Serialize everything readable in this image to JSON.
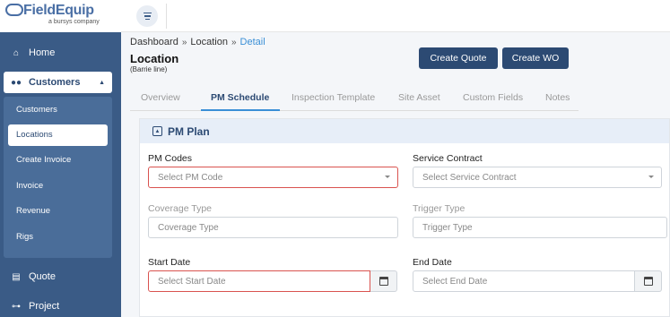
{
  "brand": {
    "name": "FieldEquip",
    "tagline": "a bursys company"
  },
  "sidebar": {
    "home": "Home",
    "customers": "Customers",
    "sub_items": [
      "Customers",
      "Locations",
      "Create Invoice",
      "Invoice",
      "Revenue",
      "Rigs"
    ],
    "active_sub": "Locations",
    "quote": "Quote",
    "project": "Project"
  },
  "breadcrumb": {
    "root": "Dashboard",
    "parent": "Location",
    "current": "Detail",
    "separator": "»"
  },
  "page": {
    "title": "Location",
    "subtitle": "(Barrie line)"
  },
  "actions": {
    "create_quote": "Create Quote",
    "create_wo": "Create WO"
  },
  "tabs": [
    "Overview",
    "PM Schedule",
    "Inspection Template",
    "Site Asset",
    "Custom Fields",
    "Notes"
  ],
  "active_tab": "PM Schedule",
  "pm_plan": {
    "title": "PM Plan",
    "pm_codes": {
      "label": "PM Codes",
      "placeholder": "Select PM Code"
    },
    "service_contract": {
      "label": "Service Contract",
      "placeholder": "Select Service Contract"
    },
    "coverage_type": {
      "label": "Coverage Type",
      "placeholder": "Coverage Type"
    },
    "trigger_type": {
      "label": "Trigger Type",
      "placeholder": "Trigger Type"
    },
    "start_date": {
      "label": "Start Date",
      "placeholder": "Select Start Date"
    },
    "end_date": {
      "label": "End Date",
      "placeholder": "Select End Date"
    }
  },
  "colors": {
    "sidebar": "#3a5b86",
    "primary_button": "#2c4a73",
    "accent": "#3a8fd6",
    "error": "#d9534f"
  }
}
